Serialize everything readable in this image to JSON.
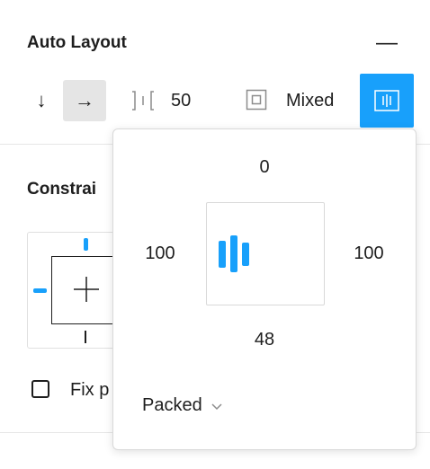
{
  "auto_layout": {
    "title": "Auto Layout",
    "collapse_glyph": "—",
    "direction_vertical_glyph": "↓",
    "direction_horizontal_glyph": "→",
    "spacing_value": "50",
    "padding_value": "Mixed"
  },
  "padding_popover": {
    "top": "0",
    "left": "100",
    "right": "100",
    "bottom": "48",
    "distribution": "Packed",
    "dropdown_glyph": "⌄"
  },
  "constraints": {
    "title": "Constrai",
    "fix_position_label": "Fix p"
  },
  "colors": {
    "accent": "#18a0fb",
    "selected_bg": "#e5e5e5"
  }
}
